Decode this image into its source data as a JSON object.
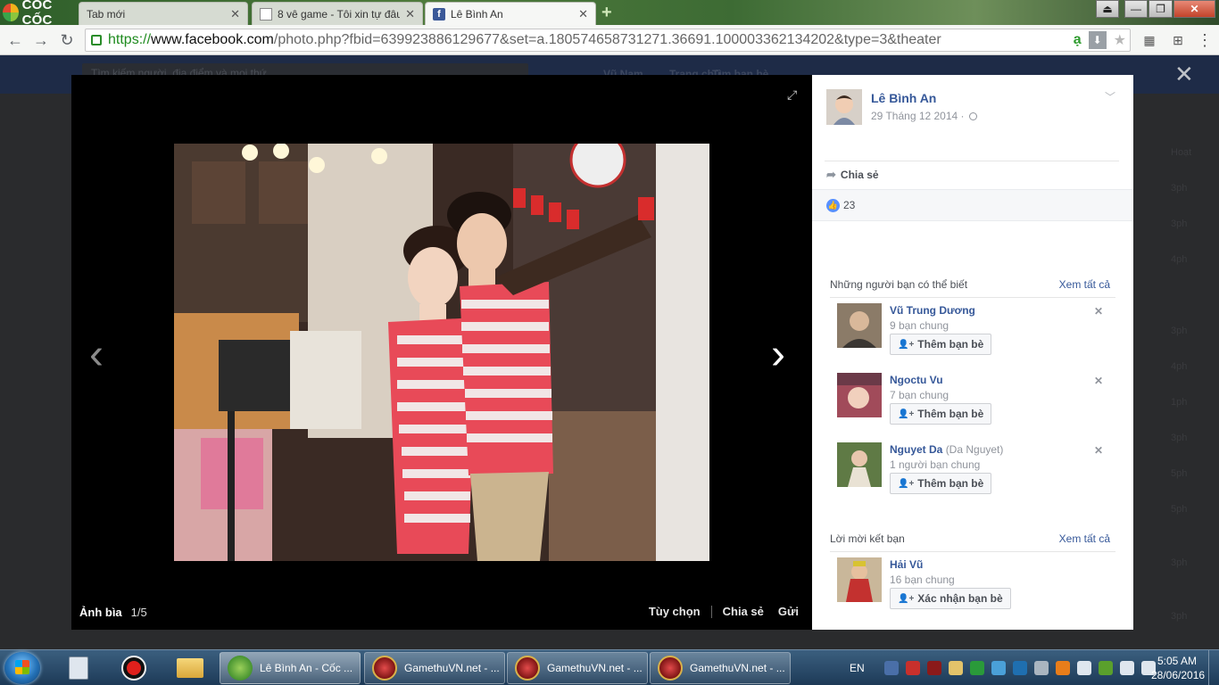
{
  "browser": {
    "brand": "CỐC CỐC",
    "tabs": [
      {
        "title": "Tab mới"
      },
      {
        "title": "8 vê game - Tôi xin tự đâu"
      },
      {
        "title": "Lê Bình An"
      }
    ],
    "url": {
      "protocol": "https://",
      "host": "www.facebook.com",
      "path": "/photo.php?fbid=639923886129677&set=a.180574658731271.36691.100003362134202&type=3&theater"
    }
  },
  "facebook_bg": {
    "search_placeholder": "Tìm kiếm người, địa điểm và mọi thứ",
    "nav": [
      "Vũ Nam",
      "Trang chủ",
      "Tìm bạn bè"
    ]
  },
  "viewer": {
    "album_label": "Ảnh bìa",
    "counter": "1/5",
    "actions": [
      "Tùy chọn",
      "Chia sẻ",
      "Gửi"
    ]
  },
  "post": {
    "owner_name": "Lê Bình An",
    "date": "29 Tháng 12 2014 ·",
    "share_label": "Chia sẻ",
    "like_count": "23"
  },
  "suggestions": {
    "heading": "Những người bạn có thể biết",
    "see_all": "Xem tất cả",
    "people": [
      {
        "name": "Vũ Trung Dương",
        "alt_name": "",
        "mutual": "9 bạn chung",
        "action": "Thêm bạn bè"
      },
      {
        "name": "Ngoctu Vu",
        "alt_name": "",
        "mutual": "7 bạn chung",
        "action": "Thêm bạn bè"
      },
      {
        "name": "Nguyet Da",
        "alt_name": "(Da Nguyet)",
        "mutual": "1 người bạn chung",
        "action": "Thêm bạn bè"
      }
    ]
  },
  "requests": {
    "heading": "Lời mời kết bạn",
    "see_all": "Xem tất cả",
    "people": [
      {
        "name": "Hải Vũ",
        "mutual": "16 bạn chung",
        "action": "Xác nhận bạn bè"
      }
    ]
  },
  "taskbar": {
    "windows": [
      {
        "title": "Lê Bình An - Cốc ..."
      },
      {
        "title": "GamethuVN.net - ..."
      },
      {
        "title": "GamethuVN.net - ..."
      },
      {
        "title": "GamethuVN.net - ..."
      }
    ],
    "language": "EN",
    "time": "5:05 AM",
    "date": "28/06/2016"
  }
}
